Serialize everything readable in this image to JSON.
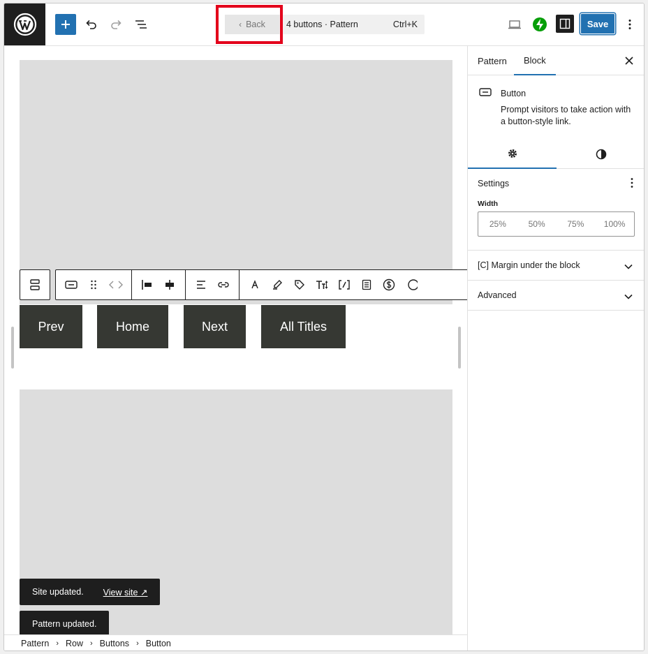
{
  "topbar": {
    "back_label": "Back",
    "document_title": "4 buttons · Pattern",
    "shortcut": "Ctrl+K",
    "save_label": "Save"
  },
  "canvas": {
    "buttons": [
      {
        "label": "Prev"
      },
      {
        "label": "Home"
      },
      {
        "label": "Next"
      },
      {
        "label": "All Titles"
      }
    ],
    "toolbar_icons": [
      "button-parent-icon",
      "button-icon",
      "drag-handle-icon",
      "move-arrows-icon",
      "justify-left-icon",
      "justify-center-icon",
      "align-text-icon",
      "link-icon",
      "text-color-icon",
      "highlight-icon",
      "tag-icon",
      "font-size-icon",
      "shortcode-icon",
      "document-icon",
      "currency-icon"
    ]
  },
  "notices": [
    {
      "text": "Site updated.",
      "link": "View site ↗"
    },
    {
      "text": "Pattern updated."
    }
  ],
  "breadcrumb": [
    "Pattern",
    "Row",
    "Buttons",
    "Button"
  ],
  "sidebar": {
    "tabs": [
      "Pattern",
      "Block"
    ],
    "active_tab": "Block",
    "block_name": "Button",
    "block_description": "Prompt visitors to take action with a button-style link.",
    "settings_title": "Settings",
    "width_label": "Width",
    "width_options": [
      "25%",
      "50%",
      "75%",
      "100%"
    ],
    "panels": [
      "[C] Margin under the block",
      "Advanced"
    ]
  },
  "colors": {
    "accent": "#2271b1",
    "button_bg": "#363833",
    "highlight_outline": "#e3001b"
  }
}
